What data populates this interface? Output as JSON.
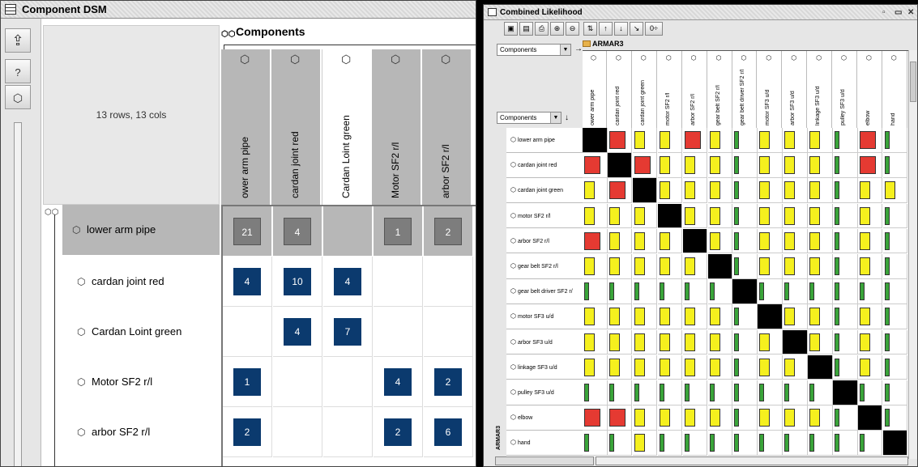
{
  "dsm": {
    "title": "Component DSM",
    "info": "13 rows, 13 cols",
    "components_header": "Components",
    "columns": [
      "ower arm pipe",
      "cardan joint red",
      "Cardan Loint green",
      "Motor SF2 r/l",
      "arbor SF2 r/l"
    ],
    "rows": [
      {
        "label": "lower arm pipe",
        "cells": [
          "21",
          "4",
          "",
          "1",
          "2"
        ]
      },
      {
        "label": "cardan joint red",
        "cells": [
          "4",
          "10",
          "4",
          "",
          ""
        ]
      },
      {
        "label": "Cardan Loint green",
        "cells": [
          "",
          "4",
          "7",
          "",
          ""
        ]
      },
      {
        "label": "Motor SF2 r/l",
        "cells": [
          "1",
          "",
          "",
          "4",
          "2"
        ]
      },
      {
        "label": "arbor SF2 r/l",
        "cells": [
          "2",
          "",
          "",
          "2",
          "6"
        ]
      }
    ],
    "colors": {
      "cell": "#0b3a6e",
      "selected_cell": "#7d7d7d",
      "selected_row": "#b7b7b7"
    }
  },
  "likelihood": {
    "title": "Combined Likelihood",
    "col_selector": "Components",
    "row_selector": "Components",
    "group_label": "ARMAR3",
    "columns": [
      "ower arm pipe",
      "cardan joint red",
      "cardan joint green",
      "motor SF2 r/l",
      "arbor SF2 r/l",
      "gear belt SF2 r/l",
      "gear belt driver SF2 r/l",
      "motor SF3 u/d",
      "arbor SF3 u/d",
      "linkage SF3 u/d",
      "pulley SF3 u/d",
      "elbow",
      "hand"
    ],
    "rows": [
      "lower arm pipe",
      "cardan joint red",
      "cardan joint green",
      "motor SF2 r/l",
      "arbor SF2 r/l",
      "gear belt SF2 r/l",
      "gear belt driver SF2 r/",
      "motor SF3 u/d",
      "arbor SF3 u/d",
      "linkage SF3 u/d",
      "pulley SF3 u/d",
      "elbow",
      "hand"
    ],
    "matrix": [
      [
        "K",
        "R",
        "Y",
        "Y",
        "R",
        "Y",
        "G",
        "Y",
        "Y",
        "Y",
        "G",
        "R",
        "G"
      ],
      [
        "R",
        "K",
        "R",
        "Y",
        "Y",
        "Y",
        "G",
        "Y",
        "Y",
        "Y",
        "G",
        "R",
        "G"
      ],
      [
        "Y",
        "R",
        "K",
        "Y",
        "Y",
        "Y",
        "G",
        "Y",
        "Y",
        "Y",
        "G",
        "Y",
        "Y"
      ],
      [
        "Y",
        "Y",
        "Y",
        "K",
        "Y",
        "Y",
        "G",
        "Y",
        "Y",
        "Y",
        "G",
        "Y",
        "G"
      ],
      [
        "R",
        "Y",
        "Y",
        "Y",
        "K",
        "Y",
        "G",
        "Y",
        "Y",
        "Y",
        "G",
        "Y",
        "G"
      ],
      [
        "Y",
        "Y",
        "Y",
        "Y",
        "Y",
        "K",
        "G",
        "Y",
        "Y",
        "Y",
        "G",
        "Y",
        "G"
      ],
      [
        "G",
        "G",
        "G",
        "G",
        "G",
        "G",
        "K",
        "G",
        "G",
        "G",
        "G",
        "G",
        "G"
      ],
      [
        "Y",
        "Y",
        "Y",
        "Y",
        "Y",
        "Y",
        "G",
        "K",
        "Y",
        "Y",
        "G",
        "Y",
        "G"
      ],
      [
        "Y",
        "Y",
        "Y",
        "Y",
        "Y",
        "Y",
        "G",
        "Y",
        "K",
        "Y",
        "G",
        "Y",
        "G"
      ],
      [
        "Y",
        "Y",
        "Y",
        "Y",
        "Y",
        "Y",
        "G",
        "Y",
        "Y",
        "K",
        "G",
        "Y",
        "G"
      ],
      [
        "G",
        "G",
        "G",
        "G",
        "G",
        "G",
        "G",
        "G",
        "G",
        "G",
        "K",
        "G",
        "G"
      ],
      [
        "R",
        "R",
        "Y",
        "Y",
        "Y",
        "Y",
        "G",
        "Y",
        "Y",
        "Y",
        "G",
        "K",
        "G"
      ],
      [
        "G",
        "G",
        "Y",
        "G",
        "G",
        "G",
        "G",
        "G",
        "G",
        "G",
        "G",
        "G",
        "K"
      ]
    ],
    "colors": {
      "R": "#e53a32",
      "Y": "#f5f01e",
      "G": "#3aa43a",
      "K": "#000000"
    }
  }
}
